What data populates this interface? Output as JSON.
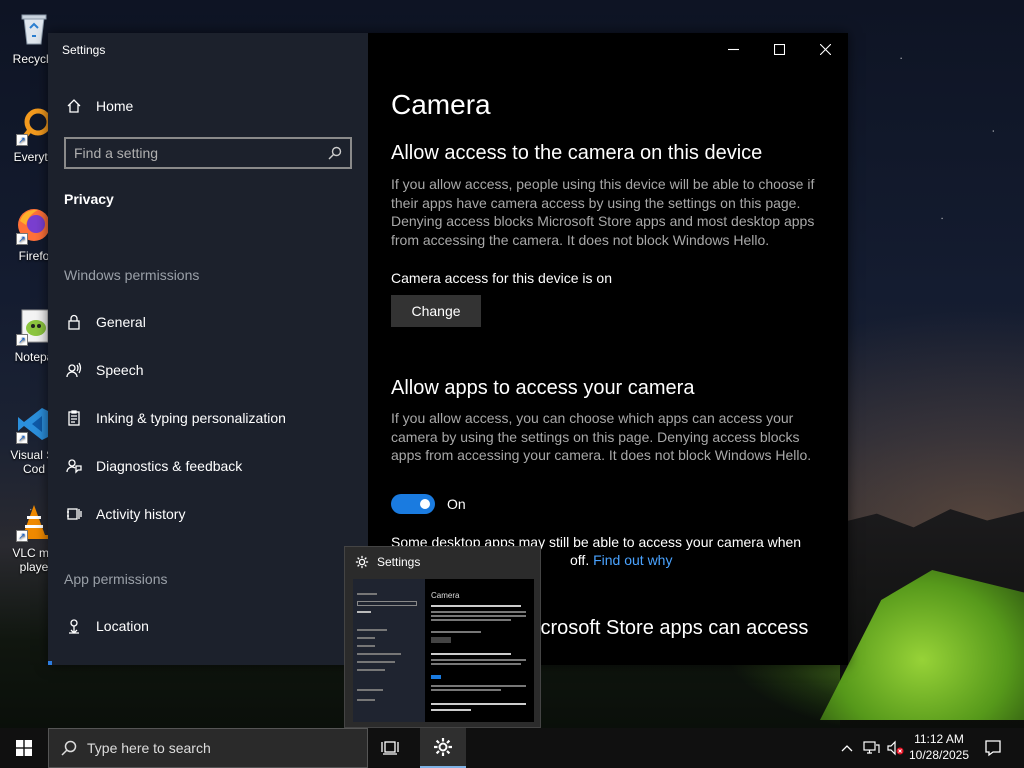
{
  "desktop": {
    "icons": [
      {
        "label": "Recycle",
        "icon": "recycle-bin-icon"
      },
      {
        "label": "Everyth",
        "icon": "everything-search-icon"
      },
      {
        "label": "Firefo",
        "icon": "firefox-icon"
      },
      {
        "label": "Notepa",
        "icon": "notepad-plus-plus-icon"
      },
      {
        "label": "Visual St",
        "label2": "Cod",
        "icon": "vscode-icon"
      },
      {
        "label": "VLC me",
        "label2": "playe",
        "icon": "vlc-icon"
      }
    ]
  },
  "window": {
    "title": "Settings",
    "controls": {
      "minimize": "minimize-icon",
      "maximize": "maximize-icon",
      "close": "close-icon"
    }
  },
  "sidebar": {
    "home_label": "Home",
    "search_placeholder": "Find a setting",
    "current_section": "Privacy",
    "windows_permissions_header": "Windows permissions",
    "windows_permissions": [
      {
        "label": "General",
        "icon": "lock-icon"
      },
      {
        "label": "Speech",
        "icon": "speech-icon"
      },
      {
        "label": "Inking & typing personalization",
        "icon": "clipboard-icon"
      },
      {
        "label": "Diagnostics & feedback",
        "icon": "feedback-icon"
      },
      {
        "label": "Activity history",
        "icon": "activity-history-icon"
      }
    ],
    "app_permissions_header": "App permissions",
    "app_permissions": [
      {
        "label": "Location",
        "icon": "location-icon"
      }
    ]
  },
  "content": {
    "page_title": "Camera",
    "device_heading": "Allow access to the camera on this device",
    "device_paragraph": "If you allow access, people using this device will be able to choose if their apps have camera access by using the settings on this page. Denying access blocks Microsoft Store apps and most desktop apps from accessing the camera. It does not block Windows Hello.",
    "device_status": "Camera access for this device is on",
    "change_button": "Change",
    "apps_heading": "Allow apps to access your camera",
    "apps_paragraph": "If you allow access, you can choose which apps can access your camera by using the settings on this page. Denying access blocks apps from accessing your camera. It does not block Windows Hello.",
    "apps_toggle_state": "On",
    "desktop_note_line1": "Some desktop apps may still be able to access your camera when",
    "desktop_note_line2": "off.",
    "find_out_why": "Find out why",
    "store_heading_partial": "icrosoft Store apps can access"
  },
  "thumbnail": {
    "title": "Settings",
    "icon": "gear-icon"
  },
  "taskbar": {
    "search_placeholder": "Type here to search",
    "time": "11:12 AM",
    "date": "10/28/2025"
  },
  "colors": {
    "accent": "#1a7be0",
    "link": "#4aa3ff",
    "sidebar_bg": "#1e2430",
    "content_bg": "#000000"
  }
}
